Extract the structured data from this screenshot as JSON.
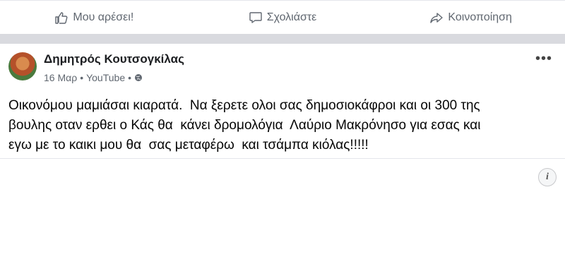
{
  "actions": {
    "like_label": "Μου αρέσει!",
    "comment_label": "Σχολιάστε",
    "share_label": "Κοινοποίηση"
  },
  "post": {
    "author": "Δημητρός Κουτσογκίλας",
    "date": "16 Μαρ",
    "source": "YouTube",
    "text": "Οικονόμου μαμιάσαι κιαρατά.  Να ξερετε ολοι σας δημοσιοκάφροι και οι 300 της\nβουλης οταν ερθει ο Κάς θα  κάνει δρομολόγια  Λαύριο Μακρόνησο για εσας και\nεγω με το καικι μου θα  σας μεταφέρω  και τσάμπα κιόλας!!!!!"
  },
  "colors": {
    "separator": "#d9dadf",
    "secondary_text": "#606770"
  },
  "icons": [
    "like-icon",
    "comment-icon",
    "share-icon",
    "globe-icon",
    "more-icon",
    "info-icon"
  ]
}
